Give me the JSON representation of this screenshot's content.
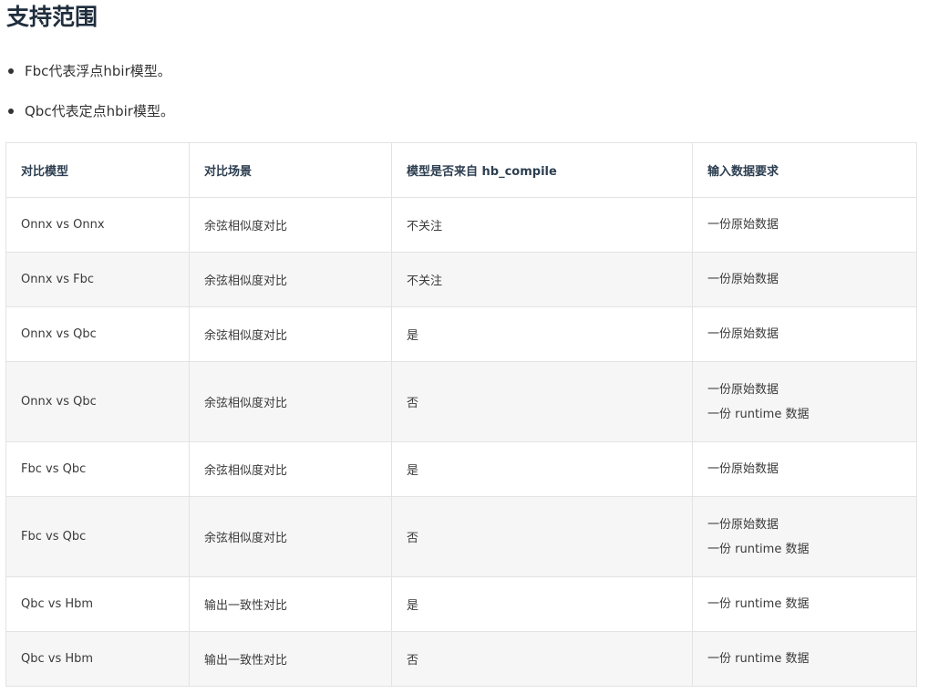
{
  "title": "支持范围",
  "bullets": [
    "Fbc代表浮点hbir模型。",
    "Qbc代表定点hbir模型。"
  ],
  "table": {
    "headers": [
      "对比模型",
      "对比场景",
      "模型是否来自 hb_compile",
      "输入数据要求"
    ],
    "rows": [
      {
        "model": "Onnx vs Onnx",
        "scene": "余弦相似度对比",
        "from_compile": "不关注",
        "input_lines": [
          "一份原始数据"
        ]
      },
      {
        "model": "Onnx vs Fbc",
        "scene": "余弦相似度对比",
        "from_compile": "不关注",
        "input_lines": [
          "一份原始数据"
        ]
      },
      {
        "model": "Onnx vs Qbc",
        "scene": "余弦相似度对比",
        "from_compile": "是",
        "input_lines": [
          "一份原始数据"
        ]
      },
      {
        "model": "Onnx vs Qbc",
        "scene": "余弦相似度对比",
        "from_compile": "否",
        "input_lines": [
          "一份原始数据",
          "一份 runtime 数据"
        ]
      },
      {
        "model": "Fbc vs Qbc",
        "scene": "余弦相似度对比",
        "from_compile": "是",
        "input_lines": [
          "一份原始数据"
        ]
      },
      {
        "model": "Fbc vs Qbc",
        "scene": "余弦相似度对比",
        "from_compile": "否",
        "input_lines": [
          "一份原始数据",
          "一份 runtime 数据"
        ]
      },
      {
        "model": "Qbc vs Hbm",
        "scene": "输出一致性对比",
        "from_compile": "是",
        "input_lines": [
          "一份 runtime 数据"
        ]
      },
      {
        "model": "Qbc vs Hbm",
        "scene": "输出一致性对比",
        "from_compile": "否",
        "input_lines": [
          "一份 runtime 数据"
        ]
      }
    ]
  }
}
